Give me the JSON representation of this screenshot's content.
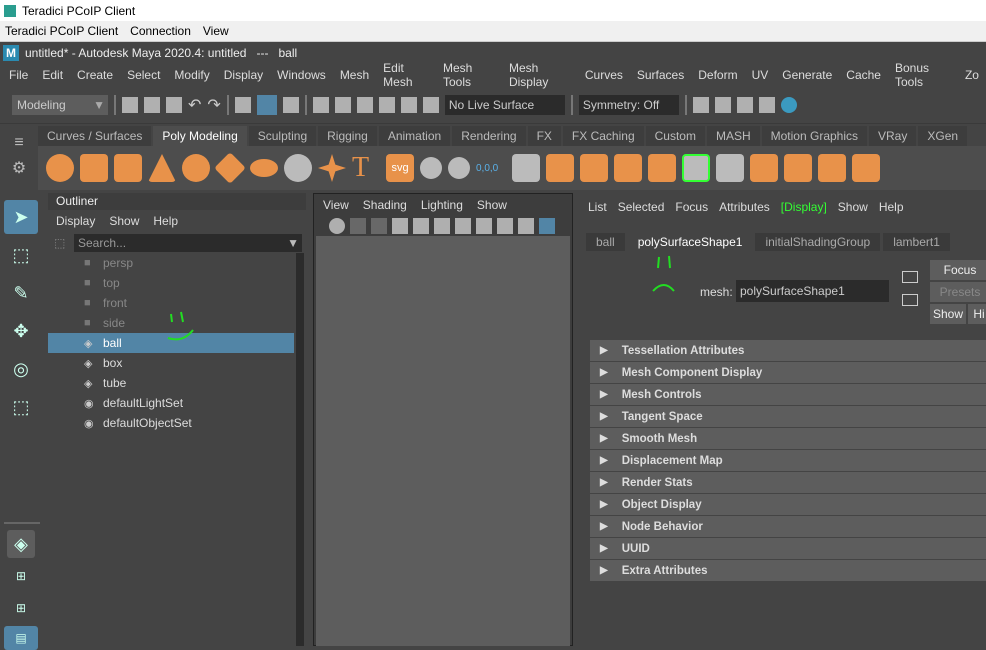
{
  "pcoip": {
    "title": "Teradici PCoIP Client",
    "menu": [
      "Teradici PCoIP Client",
      "Connection",
      "View"
    ]
  },
  "maya": {
    "title": "untitled* - Autodesk Maya 2020.4: untitled   ---   ball",
    "logo": "M",
    "menu": [
      "File",
      "Edit",
      "Create",
      "Select",
      "Modify",
      "Display",
      "Windows",
      "Mesh",
      "Edit Mesh",
      "Mesh Tools",
      "Mesh Display",
      "Curves",
      "Surfaces",
      "Deform",
      "UV",
      "Generate",
      "Cache",
      "Bonus Tools",
      "Zo"
    ]
  },
  "status": {
    "mode": "Modeling",
    "live_surface": "No Live Surface",
    "symmetry": "Symmetry: Off"
  },
  "shelf": {
    "tabs": [
      "Curves / Surfaces",
      "Poly Modeling",
      "Sculpting",
      "Rigging",
      "Animation",
      "Rendering",
      "FX",
      "FX Caching",
      "Custom",
      "MASH",
      "Motion Graphics",
      "VRay",
      "XGen"
    ],
    "active": "Poly Modeling",
    "svg_label": "svg",
    "text_label": "T",
    "coord_label": "0,0,0"
  },
  "outliner": {
    "title": "Outliner",
    "menu": [
      "Display",
      "Show",
      "Help"
    ],
    "search_placeholder": "Search...",
    "items": [
      {
        "label": "persp",
        "icon": "camera-icon"
      },
      {
        "label": "top",
        "icon": "camera-icon"
      },
      {
        "label": "front",
        "icon": "camera-icon"
      },
      {
        "label": "side",
        "icon": "camera-icon"
      },
      {
        "label": "ball",
        "icon": "mesh-icon"
      },
      {
        "label": "box",
        "icon": "mesh-icon"
      },
      {
        "label": "tube",
        "icon": "mesh-icon"
      },
      {
        "label": "defaultLightSet",
        "icon": "set-icon"
      },
      {
        "label": "defaultObjectSet",
        "icon": "set-icon"
      }
    ],
    "selected": "ball"
  },
  "viewport": {
    "menu": [
      "View",
      "Shading",
      "Lighting",
      "Show"
    ]
  },
  "attribute_editor": {
    "menu": [
      "List",
      "Selected",
      "Focus",
      "Attributes",
      "[Display]",
      "Show",
      "Help"
    ],
    "tabs": [
      "ball",
      "polySurfaceShape1",
      "initialShadingGroup",
      "lambert1"
    ],
    "active_tab": "polySurfaceShape1",
    "mesh_label": "mesh:",
    "mesh_value": "polySurfaceShape1",
    "focus": "Focus",
    "presets": "Presets",
    "show": "Show",
    "hide": "Hi",
    "sections": [
      "Tessellation Attributes",
      "Mesh Component Display",
      "Mesh Controls",
      "Tangent Space",
      "Smooth Mesh",
      "Displacement Map",
      "Render Stats",
      "Object Display",
      "Node Behavior",
      "UUID",
      "Extra Attributes"
    ]
  },
  "colors": {
    "selection": "#5285a6",
    "annotation": "#22dd22",
    "shelf_icon": "#e8924a"
  }
}
